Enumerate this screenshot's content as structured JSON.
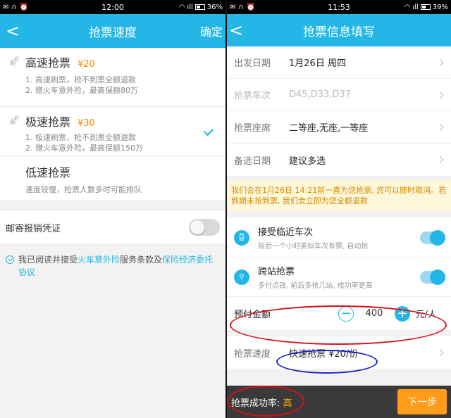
{
  "left": {
    "status": {
      "time": "12:00",
      "battery": "36%"
    },
    "title": "抢票速度",
    "confirm": "确定",
    "options": [
      {
        "name": "高速抢票",
        "price": "¥20",
        "lines": [
          "1. 高速刷票，抢不到票全额退款",
          "2. 赠火车意外险，最高保额80万"
        ],
        "selected": false,
        "icon": "rocket-icon"
      },
      {
        "name": "极速抢票",
        "price": "¥30",
        "lines": [
          "1. 极速刷票，抢不到票全额退款",
          "2. 赠火车意外险，最高保额150万"
        ],
        "selected": true,
        "icon": "rocket-icon"
      },
      {
        "name": "低速抢票",
        "price": "",
        "lines": [
          "速度较慢，抢票人数多时可能排队"
        ],
        "selected": false,
        "icon": ""
      }
    ],
    "mail_label": "邮寄报销凭证",
    "agree": {
      "prefix": "我已阅读并接受",
      "link1": "火车意外险",
      "middle": "服务条款及",
      "link2": "保险经济委托协议"
    }
  },
  "right": {
    "status": {
      "time": "11:53",
      "battery": "39%"
    },
    "title": "抢票信息填写",
    "rows": [
      {
        "label": "出发日期",
        "value": "1月26日 周四",
        "disabled": false
      },
      {
        "label": "抢票车次",
        "value": "D45,D33,D37",
        "disabled": true
      },
      {
        "label": "抢票座席",
        "value": "二等座,无座,一等座",
        "disabled": false
      },
      {
        "label": "备选日期",
        "value": "建议多选",
        "disabled": false
      }
    ],
    "notice": "我们会在1月26日 14:21前一直为您抢票, 您可以随时取消。若到期未抢到票, 我们会立即为您全额退款",
    "opt1": {
      "title": "接受临近车次",
      "sub": "前后一个小时类似车次有票, 自动抢"
    },
    "opt2": {
      "title": "跨站抢票",
      "sub": "多付点钱, 前后多抢几站, 成功率更高"
    },
    "prepay": {
      "label": "预付金额",
      "amount": "400",
      "minus": "−",
      "plus": "+",
      "unit": "元/人"
    },
    "speed": {
      "label": "抢票速度",
      "value": "快速抢票 ¥20/份"
    },
    "bottom": {
      "rate_label": "抢票成功率: ",
      "rate_value": "高",
      "next": "下一步"
    }
  }
}
